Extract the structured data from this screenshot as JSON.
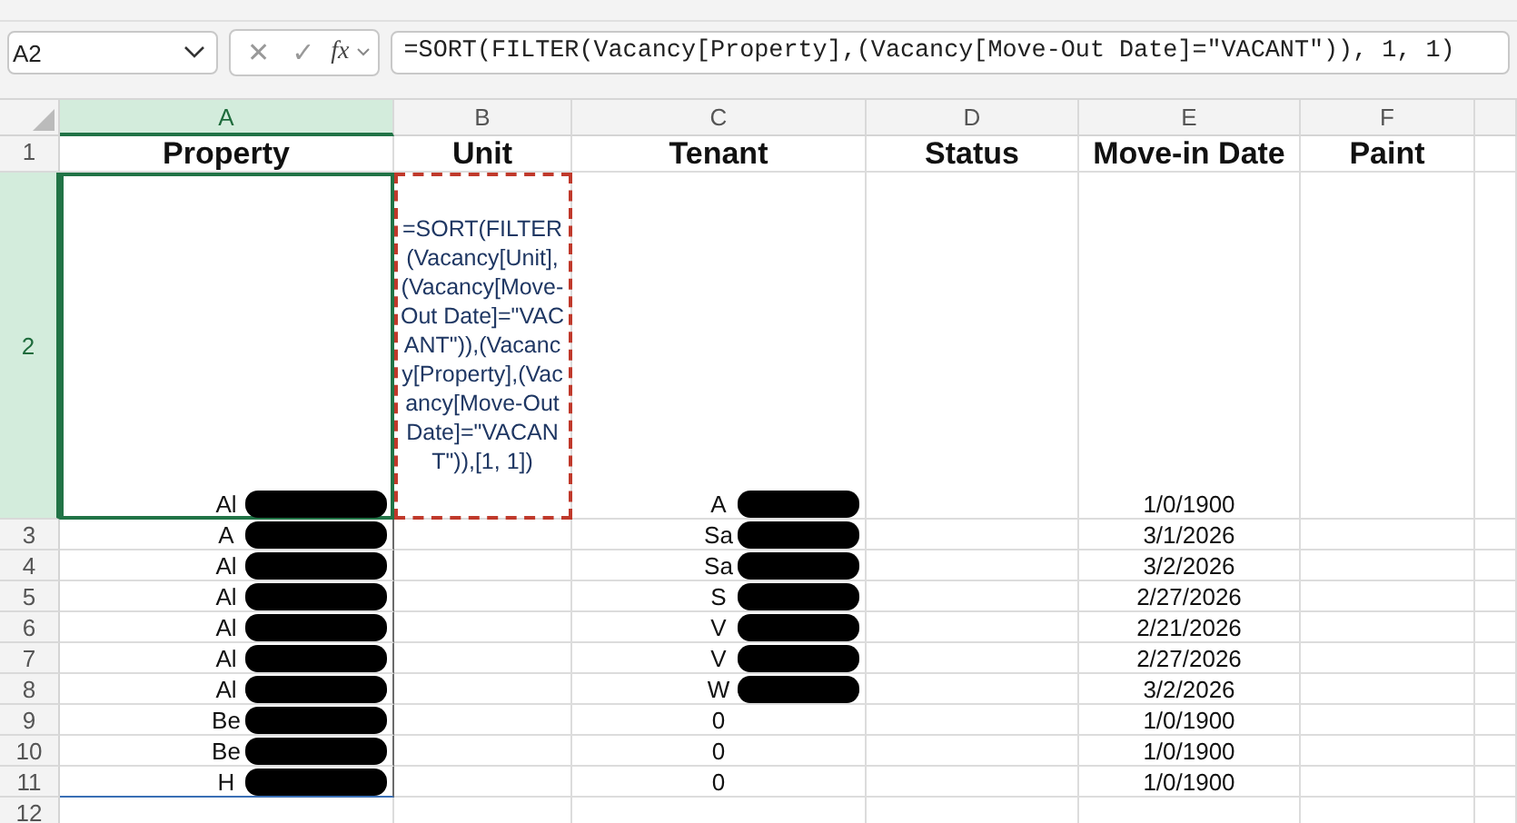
{
  "name_box": "A2",
  "formula_bar": {
    "cancel": "✕",
    "enter": "✓",
    "function": "fx",
    "formula": "=SORT(FILTER(Vacancy[Property],(Vacancy[Move-Out Date]=\"VACANT\")), 1, 1)"
  },
  "columns": [
    {
      "label": "A",
      "selected": true
    },
    {
      "label": "B",
      "selected": false
    },
    {
      "label": "C",
      "selected": false
    },
    {
      "label": "D",
      "selected": false
    },
    {
      "label": "E",
      "selected": false
    },
    {
      "label": "F",
      "selected": false
    }
  ],
  "rows": [
    {
      "number": "1",
      "selected": false,
      "kind": "header",
      "cells": {
        "A": {
          "text": "Property"
        },
        "B": {
          "text": "Unit"
        },
        "C": {
          "text": "Tenant"
        },
        "D": {
          "text": "Status"
        },
        "E": {
          "text": "Move-in Date"
        },
        "F": {
          "text": "Paint"
        }
      }
    },
    {
      "number": "2",
      "selected": true,
      "kind": "tall",
      "cells": {
        "A": {
          "text": "Al",
          "redacted": true,
          "selected": true
        },
        "B": {
          "text": "=SORT(FILTER(Vacancy[Unit],(Vacancy[Move-Out Date]=\"VACANT\")),(Vacancy[Property],(Vacancy[Move-Out Date]=\"VACANT\")),[1, 1])",
          "copied": true
        },
        "C": {
          "text": "A",
          "redacted": true
        },
        "E": {
          "text": "1/0/1900"
        }
      }
    },
    {
      "number": "3",
      "selected": false,
      "kind": "data",
      "cells": {
        "A": {
          "text": "A",
          "redacted": true
        },
        "C": {
          "text": "Sa",
          "redacted": true
        },
        "E": {
          "text": "3/1/2026"
        }
      }
    },
    {
      "number": "4",
      "selected": false,
      "kind": "data",
      "cells": {
        "A": {
          "text": "Al",
          "redacted": true
        },
        "C": {
          "text": "Sa",
          "redacted": true
        },
        "E": {
          "text": "3/2/2026"
        }
      }
    },
    {
      "number": "5",
      "selected": false,
      "kind": "data",
      "cells": {
        "A": {
          "text": "Al",
          "redacted": true
        },
        "C": {
          "text": "S",
          "redacted": true
        },
        "E": {
          "text": "2/27/2026"
        }
      }
    },
    {
      "number": "6",
      "selected": false,
      "kind": "data",
      "cells": {
        "A": {
          "text": "Al",
          "redacted": true
        },
        "C": {
          "text": "V",
          "redacted": true
        },
        "E": {
          "text": "2/21/2026"
        }
      }
    },
    {
      "number": "7",
      "selected": false,
      "kind": "data",
      "cells": {
        "A": {
          "text": "Al",
          "redacted": true
        },
        "C": {
          "text": "V",
          "redacted": true
        },
        "E": {
          "text": "2/27/2026"
        }
      }
    },
    {
      "number": "8",
      "selected": false,
      "kind": "data",
      "cells": {
        "A": {
          "text": "Al",
          "redacted": true
        },
        "C": {
          "text": "W",
          "redacted": true
        },
        "E": {
          "text": "3/2/2026"
        }
      }
    },
    {
      "number": "9",
      "selected": false,
      "kind": "data",
      "cells": {
        "A": {
          "text": "Be",
          "redacted": true
        },
        "C": {
          "text": "0"
        },
        "E": {
          "text": "1/0/1900"
        }
      }
    },
    {
      "number": "10",
      "selected": false,
      "kind": "data",
      "cells": {
        "A": {
          "text": "Be",
          "redacted": true
        },
        "C": {
          "text": "0"
        },
        "E": {
          "text": "1/0/1900"
        }
      }
    },
    {
      "number": "11",
      "selected": false,
      "kind": "data",
      "cells": {
        "A": {
          "text": "H",
          "redacted": true
        },
        "C": {
          "text": "0"
        },
        "E": {
          "text": "1/0/1900"
        }
      }
    },
    {
      "number": "12",
      "selected": false,
      "kind": "data",
      "cells": {}
    }
  ]
}
